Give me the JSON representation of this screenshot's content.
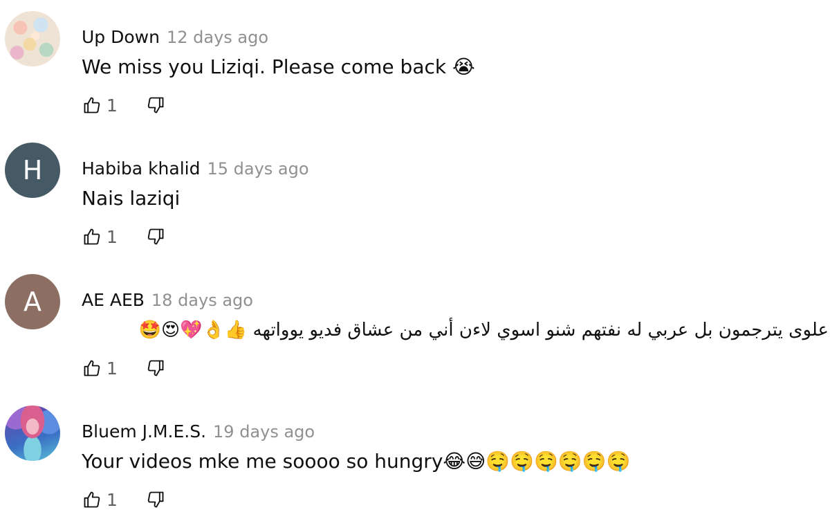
{
  "comments": [
    {
      "author": "Up Down",
      "time": "12 days ago",
      "text": "We miss you Liziqi. Please come back 😭",
      "likes": "1",
      "avatar_letter": ""
    },
    {
      "author": "Habiba khalid",
      "time": "15 days ago",
      "text": "Nais laziqi",
      "likes": "1",
      "avatar_letter": "H"
    },
    {
      "author": "AE AEB",
      "time": "18 days ago",
      "text": "علوى يترجمون بل عربي له نفتهم شنو اسوي لاءن أني من عشاق فديو يوواتهه 👍👌💖😍🤩",
      "likes": "1",
      "avatar_letter": "A"
    },
    {
      "author": "Bluem J.M.E.S.",
      "time": "19 days ago",
      "text": "Your videos mke me soooo so hungry😂😅🤤🤤🤤🤤🤤🤤",
      "likes": "1",
      "avatar_letter": ""
    }
  ],
  "colors": {
    "text": "#0f0f0f",
    "secondary": "#909090",
    "avatar_h": "#455a64",
    "avatar_a": "#8d6e63"
  },
  "icons": {
    "like": "thumb-up-icon",
    "dislike": "thumb-down-icon"
  }
}
